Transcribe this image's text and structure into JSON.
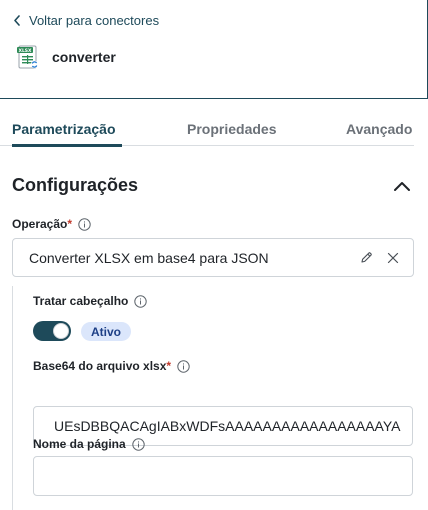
{
  "header": {
    "back_label": "Voltar para conectores",
    "connector_title": "converter",
    "connector_icon": "xlsx-file-icon",
    "icon_badge": "XLSX"
  },
  "tabs": [
    {
      "label": "Parametrização",
      "active": true
    },
    {
      "label": "Propriedades",
      "active": false
    },
    {
      "label": "Avançado",
      "active": false
    }
  ],
  "section": {
    "title": "Configurações",
    "expanded": true
  },
  "operation": {
    "label": "Operação",
    "required_marker": "*",
    "value": "Converter XLSX em base4 para JSON"
  },
  "header_toggle": {
    "label": "Tratar cabeçalho",
    "on": true,
    "status": "Ativo"
  },
  "base64": {
    "label": "Base64 do arquivo xlsx",
    "required_marker": "*",
    "value": "UEsDBBQACAgIABxWDFsAAAAAAAAAAAAAAAAAYA"
  },
  "page_name": {
    "label": "Nome da página",
    "value": ""
  },
  "colors": {
    "accent": "#1e4a5a",
    "required": "#c0392b",
    "badge_bg": "#dbe6fb",
    "badge_text": "#1d3f86"
  }
}
